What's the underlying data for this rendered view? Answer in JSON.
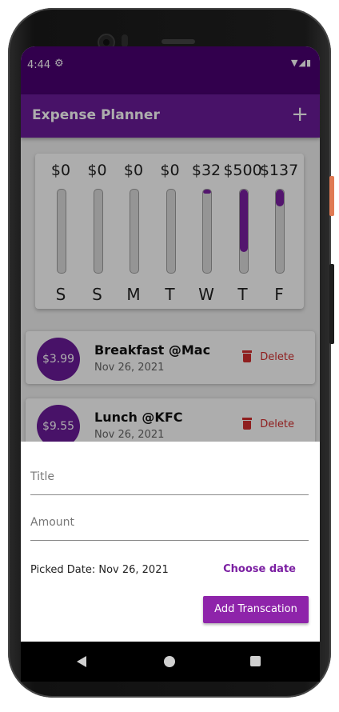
{
  "status_bar": {
    "time": "4:44",
    "settings_icon": "gear-icon",
    "right_icons": [
      "wifi-icon",
      "signal-icon",
      "battery-icon"
    ]
  },
  "app_bar": {
    "title": "Expense Planner",
    "add_icon": "+"
  },
  "chart_data": {
    "type": "bar",
    "categories": [
      "S",
      "S",
      "M",
      "T",
      "W",
      "T",
      "F"
    ],
    "labels": [
      "$0",
      "$0",
      "$0",
      "$0",
      "$32",
      "$500",
      "$137"
    ],
    "values": [
      0,
      0,
      0,
      0,
      32,
      500,
      137
    ],
    "fractions": [
      0,
      0,
      0,
      0,
      0.048,
      0.75,
      0.2
    ],
    "colors": {
      "fill": "#7b1fa2",
      "track": "#dcdcdc"
    }
  },
  "transactions": [
    {
      "amount": "$3.99",
      "title": "Breakfast @Mac",
      "date": "Nov 26, 2021",
      "action": "Delete"
    },
    {
      "amount": "$9.55",
      "title": "Lunch @KFC",
      "date": "Nov 26, 2021",
      "action": "Delete"
    }
  ],
  "form": {
    "title_placeholder": "Title",
    "amount_placeholder": "Amount",
    "picked_date": "Picked Date: Nov 26, 2021",
    "choose_date": "Choose date",
    "submit": "Add Transcation"
  },
  "colors": {
    "primary": "#6a1b9a",
    "primary_dark": "#4a0072",
    "accent": "#8e24aa",
    "delete": "#d32f2f"
  }
}
